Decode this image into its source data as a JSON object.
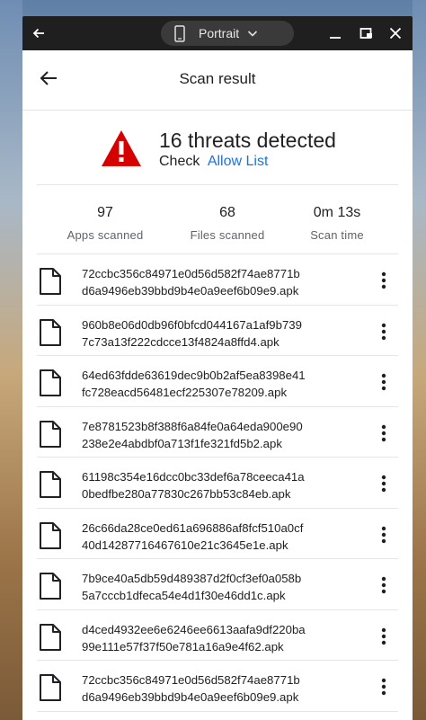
{
  "titlebar": {
    "orientation_label": "Portrait",
    "icons": [
      "back-arrow-icon",
      "phone-icon",
      "chevron-down-icon",
      "minimize-icon",
      "restore-icon",
      "close-icon"
    ]
  },
  "appbar": {
    "title": "Scan result",
    "back_icon": "arrow-back-icon"
  },
  "summary": {
    "headline": "16 threats detected",
    "check_text": "Check",
    "allow_list_link": "Allow List",
    "icon": "warning-triangle-icon",
    "icon_color": "#d50000",
    "link_color": "#1a73e8"
  },
  "stats": [
    {
      "value": "97",
      "label": "Apps scanned"
    },
    {
      "value": "68",
      "label": "Files scanned"
    },
    {
      "value": "0m 13s",
      "label": "Scan time"
    }
  ],
  "files": [
    {
      "line1": "72ccbc356c84971e0d56d582f74ae8771b",
      "line2": "d6a9496eb39bbd9b4e0a9eef6b09e9.apk"
    },
    {
      "line1": "960b8e06d0db96f0bfcd044167a1af9b739",
      "line2": "7c73a13f222cdcce13f4824a8ffd4.apk"
    },
    {
      "line1": "64ed63fdde63619dec9b0b2af5ea8398e41",
      "line2": "fc728eacd56481ecf225307e78209.apk"
    },
    {
      "line1": "7e8781523b8f388f6a84fe0a64eda900e90",
      "line2": "238e2e4abdbf0a713f1fe321fd5b2.apk"
    },
    {
      "line1": "61198c354e16dcc0bc33def6a78ceeca41a",
      "line2": "0bedfbe280a77830c267bb53c84eb.apk"
    },
    {
      "line1": "26c66da28ce0ed61a696886af8fcf510a0cf",
      "line2": "40d14287716467610e21c3645e1e.apk"
    },
    {
      "line1": "7b9ce40a5db59d489387d2f0cf3ef0a058b",
      "line2": "5a7cccb1dfeca54e4d1f30e46dd1c.apk"
    },
    {
      "line1": "d4ced4932ee6e6246ee6613aafa9df220ba",
      "line2": "99e111e57f37f50e781a16a9e4f62.apk"
    },
    {
      "line1": "72ccbc356c84971e0d56d582f74ae8771b",
      "line2": "d6a9496eb39bbd9b4e0a9eef6b09e9.apk"
    }
  ]
}
